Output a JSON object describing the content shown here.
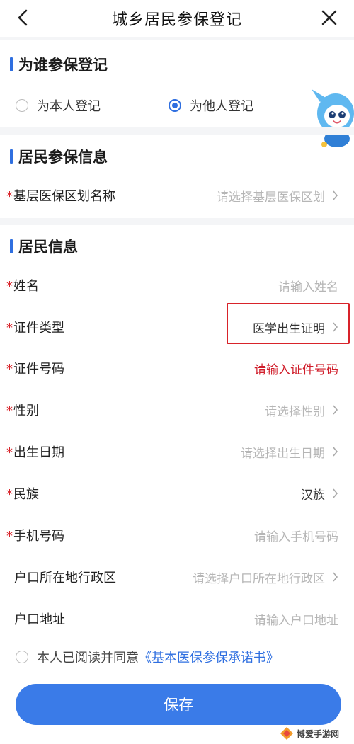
{
  "header": {
    "title": "城乡居民参保登记",
    "back_icon": "chevron-left-icon",
    "close_icon": "close-icon"
  },
  "section_register": {
    "title": "为谁参保登记",
    "options": [
      {
        "label": "为本人登记",
        "selected": false
      },
      {
        "label": "为他人登记",
        "selected": true
      }
    ]
  },
  "section_insurance": {
    "title": "居民参保信息",
    "fields": [
      {
        "required": "*",
        "label": "基层医保区划名称",
        "value": "请选择基层医保区划",
        "arrow": true
      }
    ]
  },
  "section_resident": {
    "title": "居民信息",
    "fields": [
      {
        "required": "*",
        "label": "姓名",
        "value": "请输入姓名",
        "arrow": false
      },
      {
        "required": "*",
        "label": "证件类型",
        "value": "医学出生证明",
        "arrow": true
      },
      {
        "required": "*",
        "label": "证件号码",
        "value": "请输入证件号码",
        "arrow": false
      },
      {
        "required": "*",
        "label": "性别",
        "value": "请选择性别",
        "arrow": true
      },
      {
        "required": "*",
        "label": "出生日期",
        "value": "请选择出生日期",
        "arrow": true
      },
      {
        "required": "*",
        "label": "民族",
        "value": "汉族",
        "arrow": true
      },
      {
        "required": "*",
        "label": "手机号码",
        "value": "请输入手机号码",
        "arrow": false
      },
      {
        "required": "",
        "label": "户口所在地行政区",
        "value": "请选择户口所在地行政区",
        "arrow": true
      },
      {
        "required": "",
        "label": "户口地址",
        "value": "请输入户口地址",
        "arrow": false
      }
    ]
  },
  "agreement": {
    "text": "本人已阅读并同意",
    "link": "《基本医保参保承诺书》",
    "checked": false
  },
  "save_button": {
    "label": "保存"
  },
  "watermark": {
    "text": "博爱手游网"
  },
  "colors": {
    "accent": "#3a7be8",
    "required": "#d8232a",
    "placeholder": "#b6b6b6",
    "error_text": "#d01d2a"
  }
}
